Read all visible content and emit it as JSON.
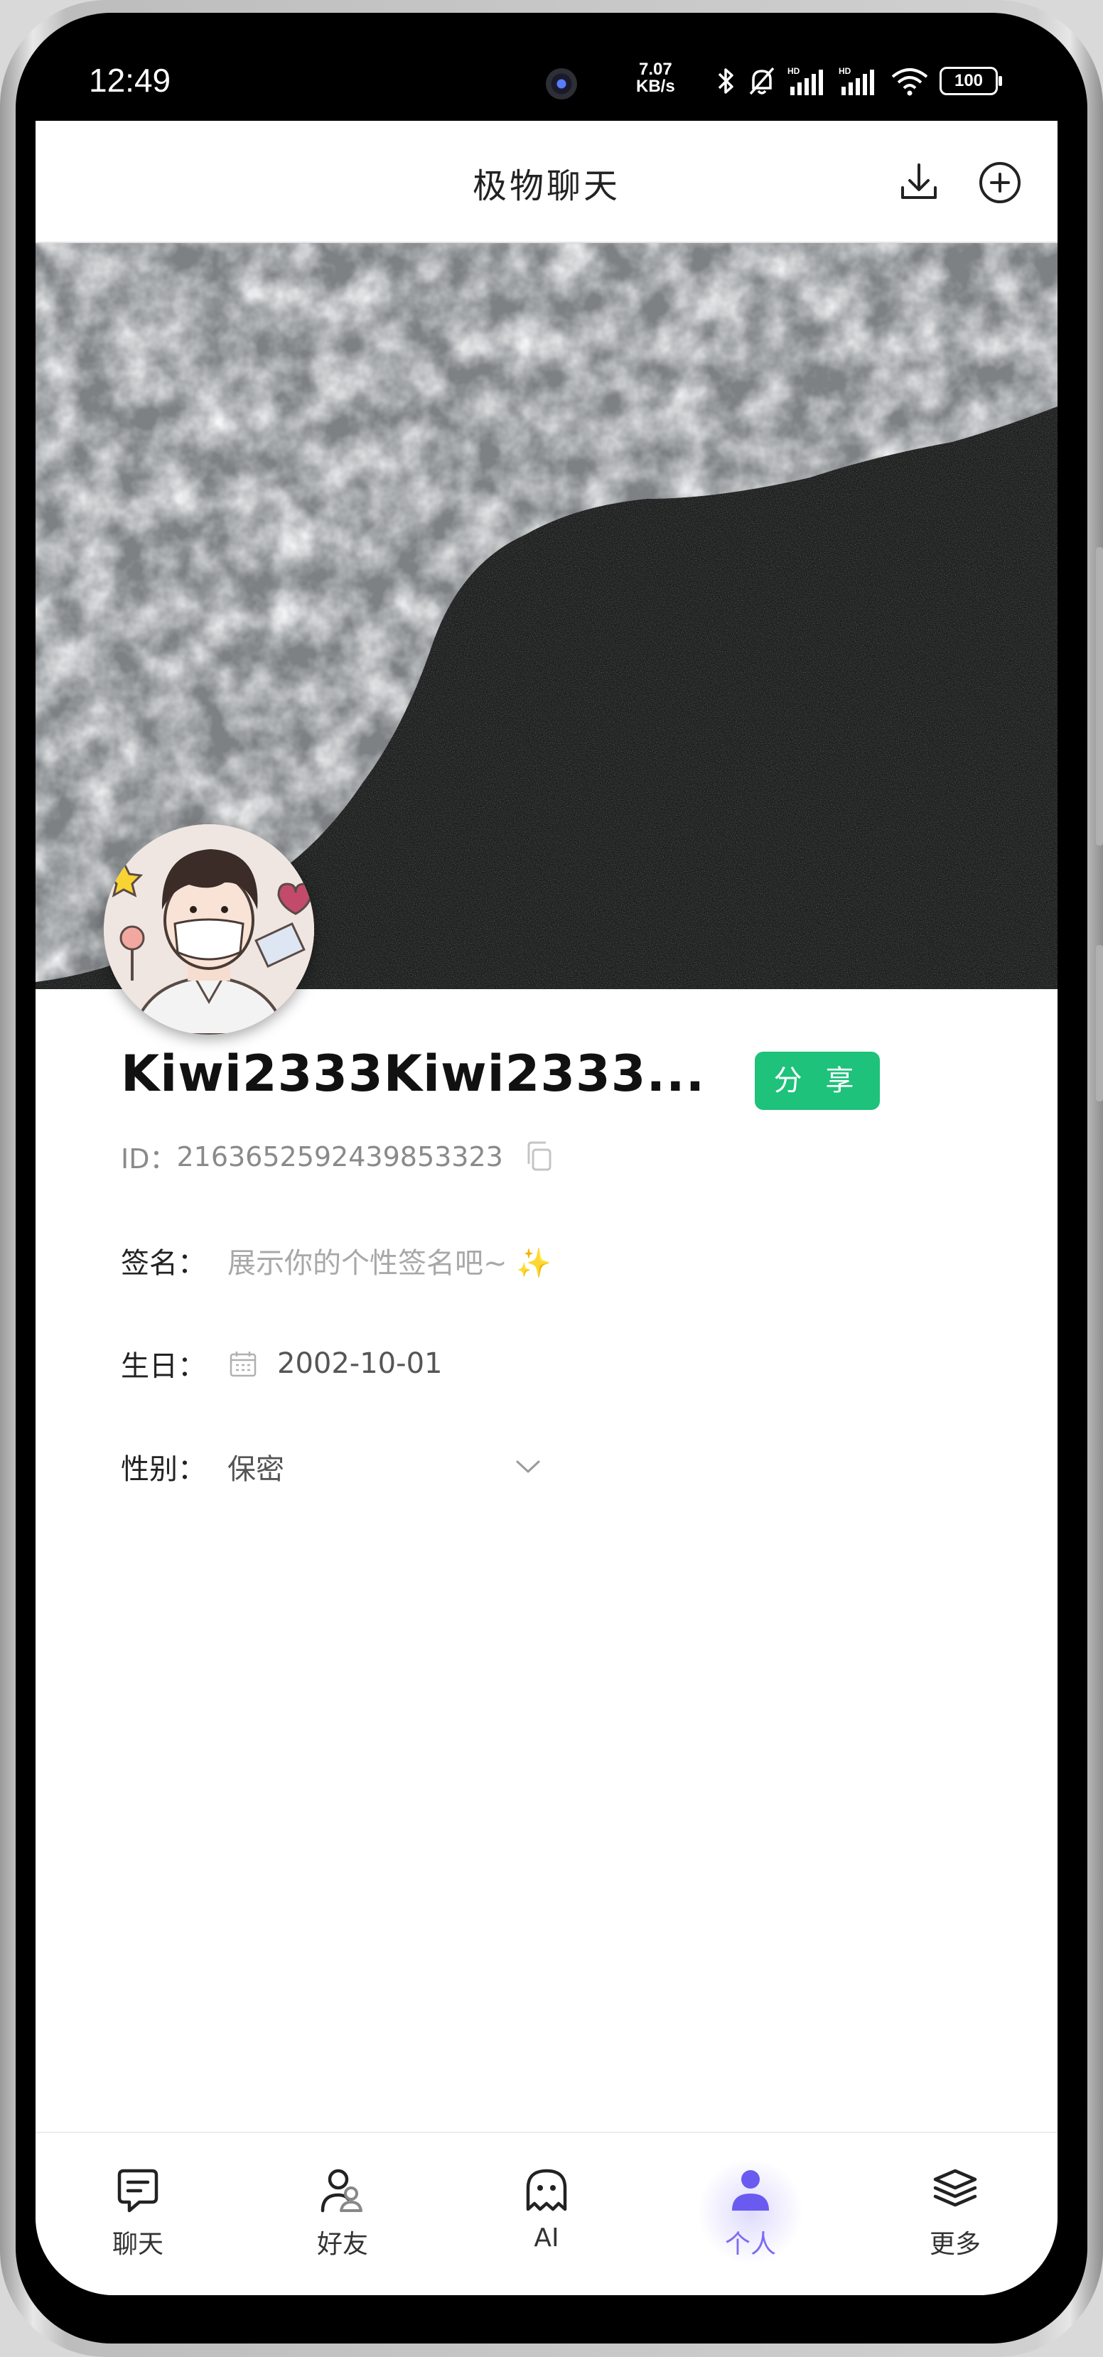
{
  "status_bar": {
    "time": "12:49",
    "net_speed_value": "7.07",
    "net_speed_unit": "KB/s",
    "battery": "100"
  },
  "header": {
    "title": "极物聊天"
  },
  "profile": {
    "name": "Kiwi2333Kiwi2333...",
    "share_label": "分 享",
    "id_label": "ID：",
    "id_value": "2163652592439853323",
    "signature_label": "签名：",
    "signature_placeholder": "展示你的个性签名吧~ ✨",
    "birthday_label": "生日：",
    "birthday_value": "2002-10-01",
    "gender_label": "性别：",
    "gender_value": "保密"
  },
  "tabs": [
    {
      "label": "聊天",
      "icon": "chat-icon"
    },
    {
      "label": "好友",
      "icon": "friends-icon"
    },
    {
      "label": "AI",
      "icon": "ghost-icon"
    },
    {
      "label": "个人",
      "icon": "person-icon",
      "active": true
    },
    {
      "label": "更多",
      "icon": "layers-icon"
    }
  ],
  "colors": {
    "accent": "#7c6cf2",
    "share_button": "#1ec27a"
  }
}
